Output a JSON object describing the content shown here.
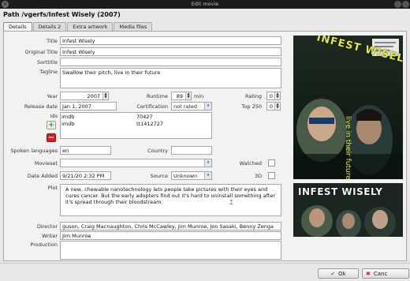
{
  "window": {
    "title": "Edit movie",
    "close_glyph": "×"
  },
  "path_label": "Path /vgerfs/Infest Wisely (2007)",
  "tabs": [
    "Details",
    "Details 2",
    "Extra artwork",
    "Media files"
  ],
  "active_tab": "Details",
  "labels": {
    "title": "Title",
    "original_title": "Original Title",
    "sorttitle": "Sorttitle",
    "tagline": "Tagline",
    "year": "Year",
    "runtime": "Runtime",
    "runtime_unit": "min",
    "rating": "Rating",
    "release_date": "Release date",
    "certification": "Certification",
    "top250": "Top 250",
    "ids": "Ids",
    "spoken_languages": "Spoken languages",
    "country": "Country",
    "movieset": "Movieset",
    "watched": "Watched",
    "date_added": "Date Added",
    "source": "Source",
    "three_d": "3D",
    "plot": "Plot",
    "director": "Director",
    "writer": "Writer",
    "production": "Production"
  },
  "values": {
    "title": "Infest Wisely",
    "original_title": "Infest Wisely",
    "sorttitle": "",
    "tagline": "Swallow their pitch, live in their future",
    "year": "2007",
    "runtime": "89",
    "rating": "0",
    "release_date": "Jan 1, 2007",
    "certification": "not rated",
    "top250": "0",
    "ids": [
      {
        "provider": "imdb",
        "value": "70427"
      },
      {
        "provider": "imdb",
        "value": "tt1412727"
      }
    ],
    "spoken_languages": "en",
    "country": "",
    "movieset": "",
    "date_added": "9/21/20 2:32 PM",
    "source": "Unknown",
    "plot": "A new, chewable nanotechnology lets people take pictures with their eyes and cures cancer. But the early adopters find out it's hard to uninstall something after it's spread through their bloodstream.",
    "director": "guson, Craig Macnaughton, Chris McCawley, Jim Munroe, Jon Sasaki, Benny Zenga",
    "writer": "Jim Munroe",
    "production": ""
  },
  "poster": {
    "title_art": "INFEST WISELY",
    "tagline_art": "live in their future",
    "banner_art": "INFEST WISELY"
  },
  "buttons": {
    "add_id": "+",
    "remove_id": "−",
    "ok": "Ok",
    "ok_glyph": "✔",
    "cancel": "Canc",
    "cancel_glyph": "✖"
  },
  "colors": {
    "accent_green": "#3aa02a",
    "remove_red": "#d22020",
    "poster_yellow": "#e4ea3a"
  }
}
